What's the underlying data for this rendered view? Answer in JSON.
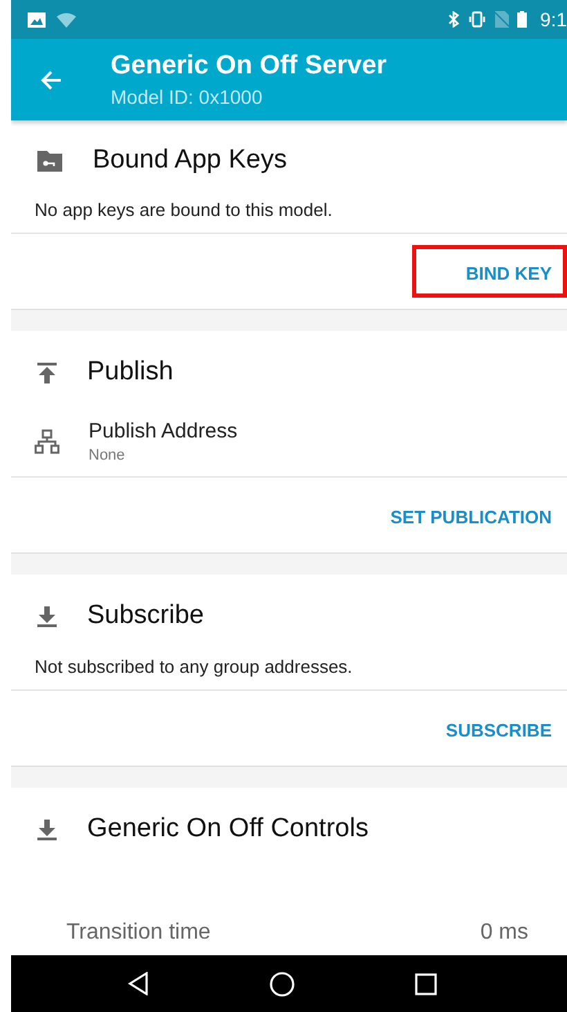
{
  "status_bar": {
    "time": "9:1"
  },
  "toolbar": {
    "title": "Generic On Off Server",
    "subtitle": "Model ID: 0x1000"
  },
  "sections": [
    {
      "kind": "keys",
      "title": "Bound App Keys",
      "message": "No app keys are bound to this model.",
      "action": {
        "label": "BIND KEY",
        "highlighted": true
      }
    },
    {
      "kind": "publish",
      "title": "Publish",
      "item": {
        "label": "Publish Address",
        "value": "None"
      },
      "action": {
        "label": "SET PUBLICATION",
        "highlighted": false
      }
    },
    {
      "kind": "subscribe",
      "title": "Subscribe",
      "message": "Not subscribed to any group addresses.",
      "action": {
        "label": "SUBSCRIBE",
        "highlighted": false
      }
    },
    {
      "kind": "controls",
      "title": "Generic On Off Controls",
      "setting": {
        "label": "Transition time",
        "value": "0 ms"
      }
    }
  ]
}
